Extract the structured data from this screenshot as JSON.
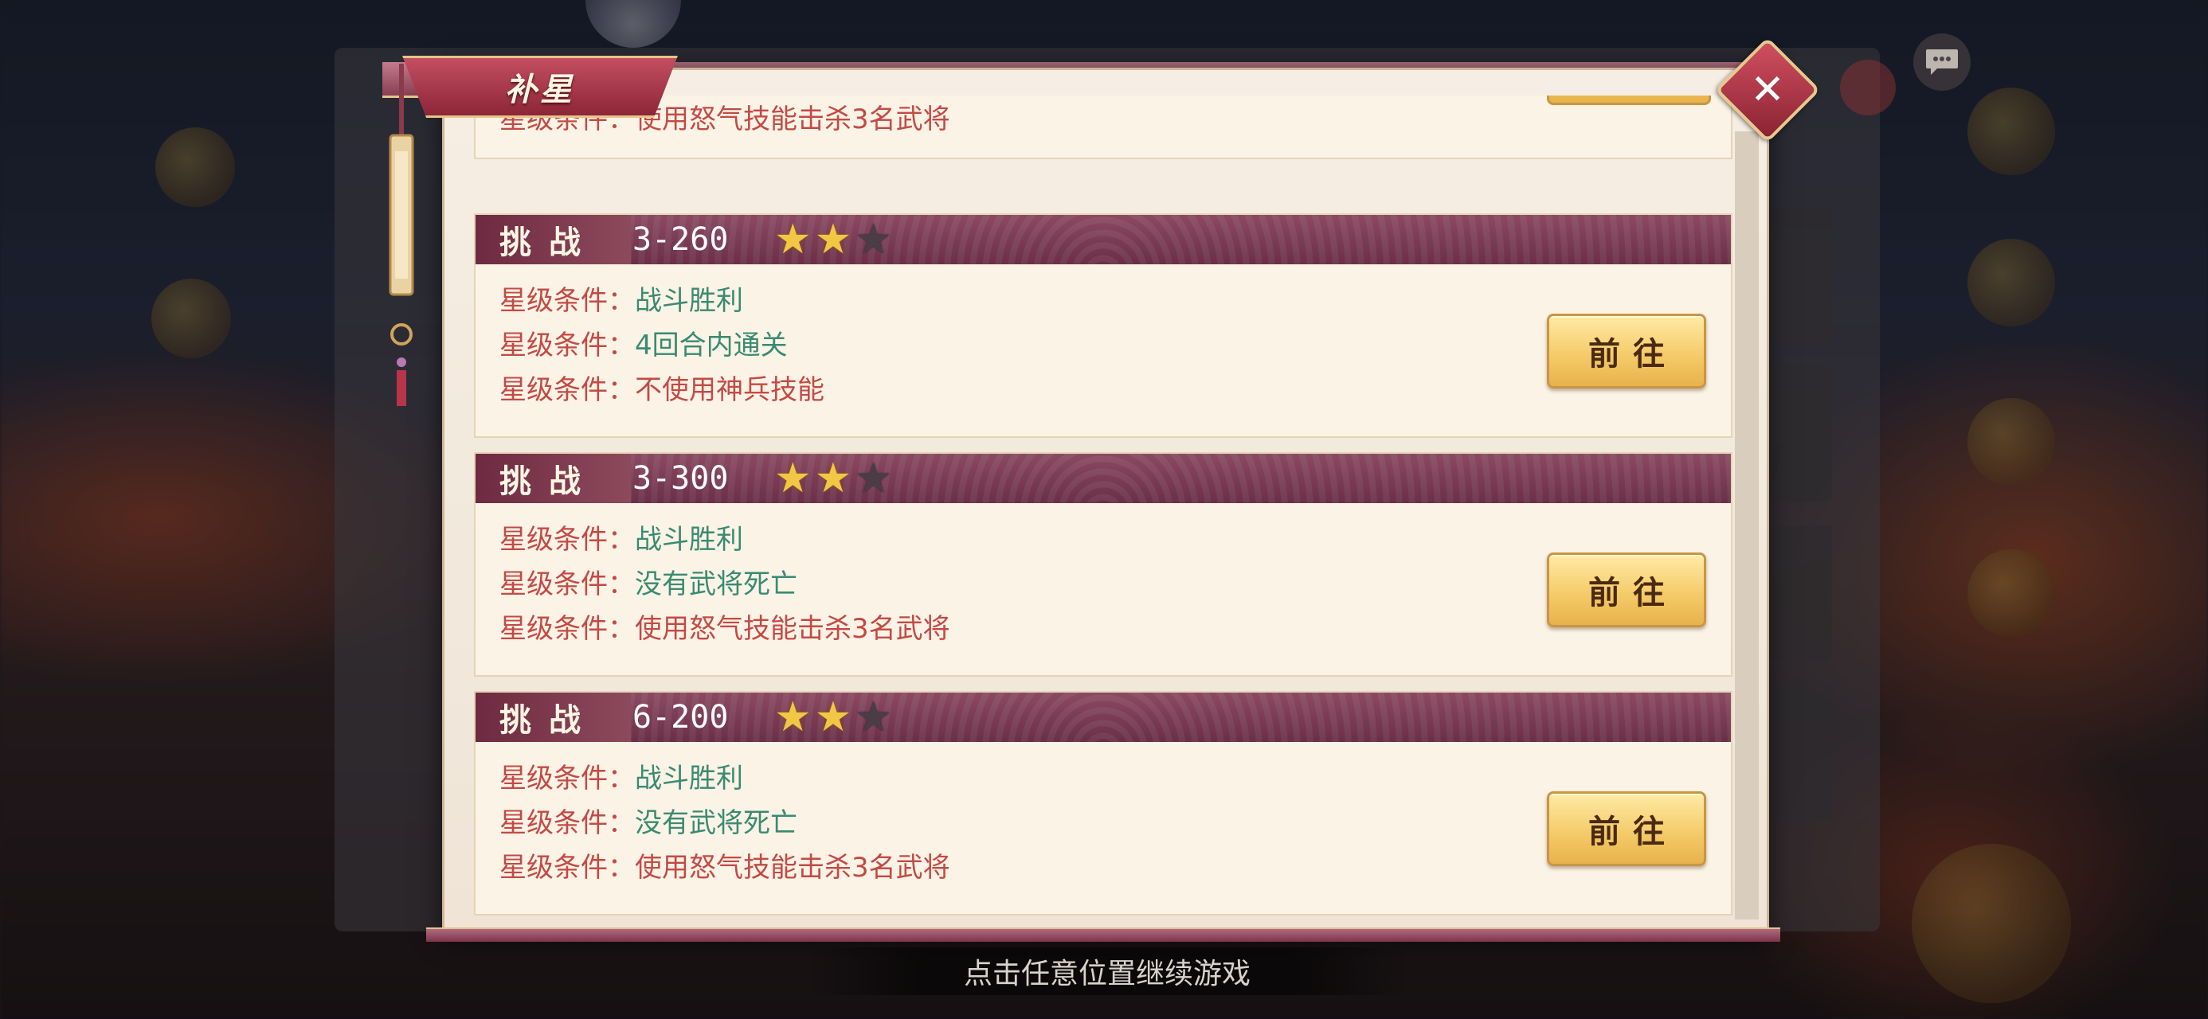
{
  "dialog": {
    "title": "补星",
    "close_icon": "close-icon"
  },
  "partial_card": {
    "condition": {
      "key": "星级条件：",
      "value": "使用怒气技能击杀3名武将"
    }
  },
  "cards": [
    {
      "badge": "挑战",
      "stage": "3-260",
      "stars_earned": 2,
      "stars_total": 3,
      "conditions": [
        {
          "key": "星级条件：",
          "value": "战斗胜利",
          "status": "done"
        },
        {
          "key": "星级条件：",
          "value": "4回合内通关",
          "status": "done"
        },
        {
          "key": "星级条件：",
          "value": "不使用神兵技能",
          "status": "pending"
        }
      ],
      "button": "前往"
    },
    {
      "badge": "挑战",
      "stage": "3-300",
      "stars_earned": 2,
      "stars_total": 3,
      "conditions": [
        {
          "key": "星级条件：",
          "value": "战斗胜利",
          "status": "done"
        },
        {
          "key": "星级条件：",
          "value": "没有武将死亡",
          "status": "done"
        },
        {
          "key": "星级条件：",
          "value": "使用怒气技能击杀3名武将",
          "status": "pending"
        }
      ],
      "button": "前往"
    },
    {
      "badge": "挑战",
      "stage": "6-200",
      "stars_earned": 2,
      "stars_total": 3,
      "conditions": [
        {
          "key": "星级条件：",
          "value": "战斗胜利",
          "status": "done"
        },
        {
          "key": "星级条件：",
          "value": "没有武将死亡",
          "status": "done"
        },
        {
          "key": "星级条件：",
          "value": "使用怒气技能击杀3名武将",
          "status": "pending"
        }
      ],
      "button": "前往"
    }
  ],
  "footer": {
    "continue_text": "点击任意位置继续游戏"
  },
  "colors": {
    "condition_done": "#3a8a72",
    "condition_pending": "#c34a45",
    "star_on": "#f2c744",
    "star_off": "#4a3d46"
  }
}
